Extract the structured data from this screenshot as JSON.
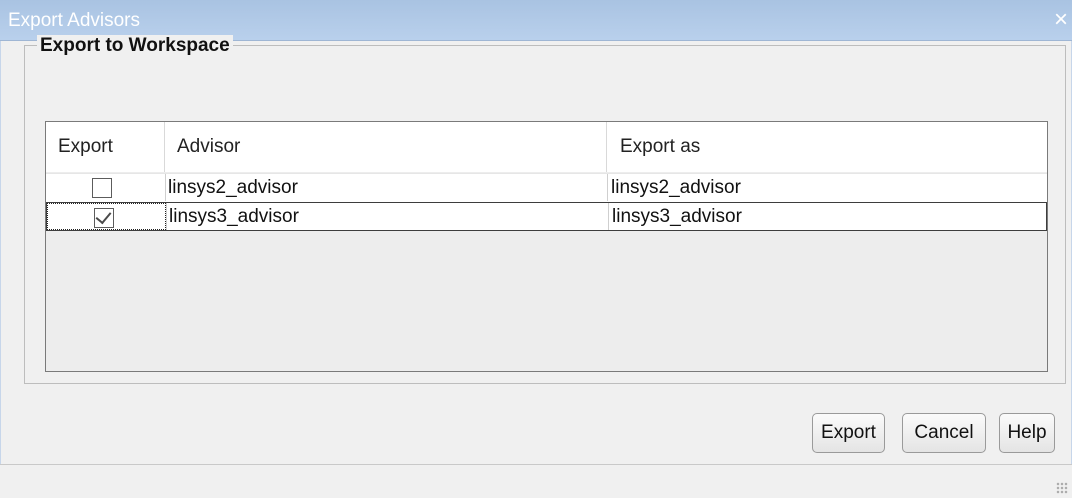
{
  "window": {
    "title": "Export Advisors",
    "close_glyph": "×"
  },
  "group": {
    "label": "Export to Workspace"
  },
  "table": {
    "headers": [
      "Export",
      "Advisor",
      "Export as"
    ],
    "rows": [
      {
        "export": false,
        "advisor": "linsys2_advisor",
        "export_as": "linsys2_advisor"
      },
      {
        "export": true,
        "advisor": "linsys3_advisor",
        "export_as": "linsys3_advisor"
      }
    ]
  },
  "buttons": {
    "export": "Export",
    "cancel": "Cancel",
    "help": "Help"
  }
}
